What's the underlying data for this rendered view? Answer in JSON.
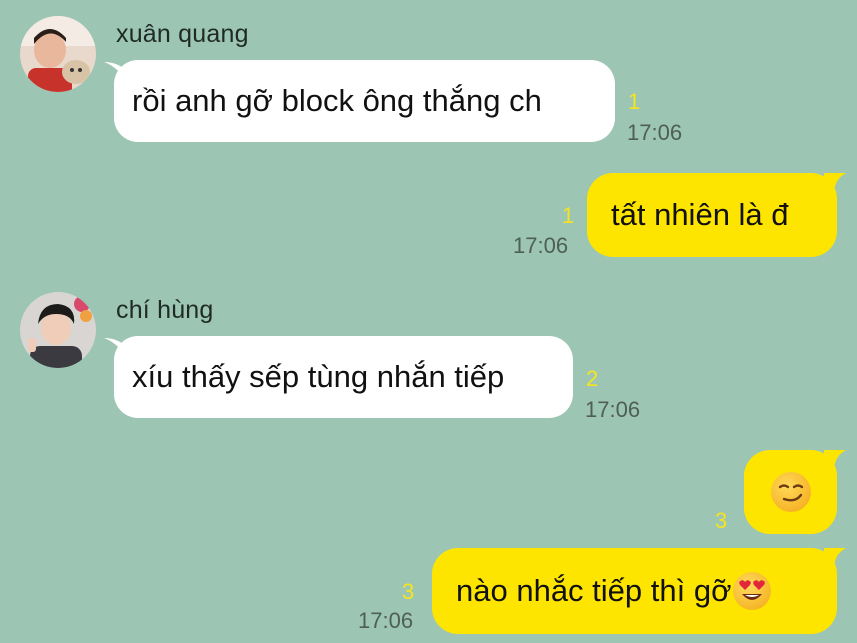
{
  "messages": [
    {
      "sender": "xuân quang",
      "text": "rồi anh gỡ block ông thắng ch",
      "read_count": "1",
      "time": "17:06"
    },
    {
      "text": "tất nhiên là đ",
      "read_count": "1",
      "time": "17:06"
    },
    {
      "sender": "chí hùng",
      "text": "xíu thấy sếp tùng nhắn tiếp",
      "read_count": "2",
      "time": "17:06"
    },
    {
      "emoji": "smirk-emoji",
      "read_count": "3"
    },
    {
      "text": "nào nhắc tiếp thì gỡ",
      "emoji": "heart-eyes-emoji",
      "read_count": "3",
      "time": "17:06"
    }
  ],
  "colors": {
    "background": "#9cc5b4",
    "incoming_bubble": "#ffffff",
    "outgoing_bubble": "#fee500",
    "read_count": "#f6e51e",
    "time": "#4f5f58"
  }
}
